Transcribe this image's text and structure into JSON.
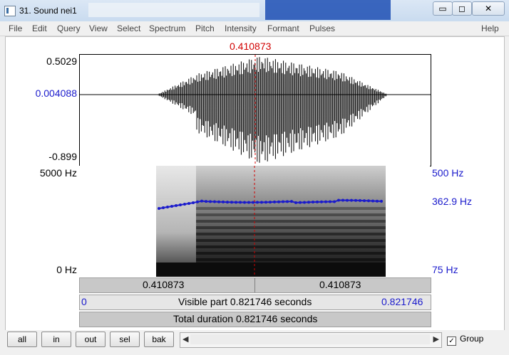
{
  "window": {
    "title": "31. Sound nei1",
    "min_glyph": "▭",
    "max_glyph": "◻",
    "close_glyph": "✕"
  },
  "menu": [
    "File",
    "Edit",
    "Query",
    "View",
    "Select",
    "Spectrum",
    "Pitch",
    "Intensity",
    "Formant",
    "Pulses"
  ],
  "help_label": "Help",
  "cursor_time": "0.410873",
  "waveform": {
    "max_label": "0.5029",
    "mid_label": "0.004088",
    "min_label": "-0.899"
  },
  "spectrogram": {
    "max_freq_label": "5000 Hz",
    "min_freq_label": "0 Hz",
    "pitch_top_label": "500 Hz",
    "pitch_value_label": "362.9 Hz",
    "pitch_bottom_label": "75 Hz"
  },
  "time_rows": {
    "left_segment": "0.410873",
    "right_segment": "0.410873",
    "visible_start": "0",
    "visible_text": "Visible part 0.821746 seconds",
    "visible_end": "0.821746",
    "total_text": "Total duration 0.821746 seconds"
  },
  "buttons": {
    "all": "all",
    "in": "in",
    "out": "out",
    "sel": "sel",
    "bak": "bak"
  },
  "group_label": "Group",
  "group_checked": true,
  "colors": {
    "cursor": "#d10000",
    "pitch": "#1a1acc"
  }
}
